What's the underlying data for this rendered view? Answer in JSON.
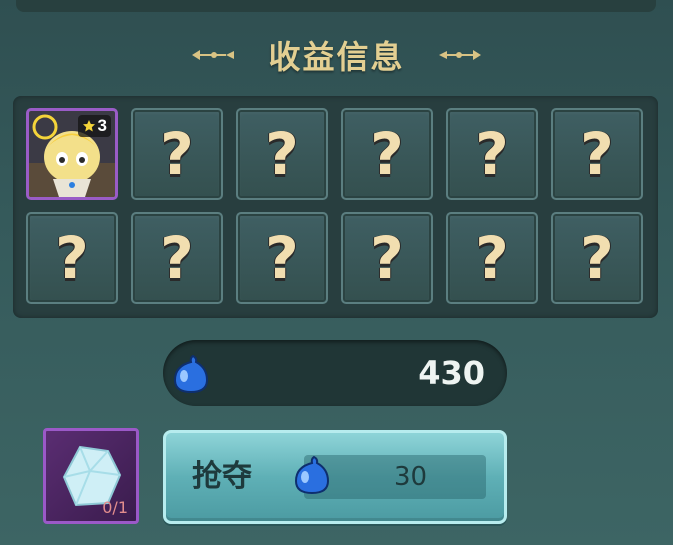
{
  "header": {
    "title": "收益信息",
    "title_color": "#e3cf92"
  },
  "reward_grid": {
    "rows": 2,
    "columns": 6,
    "slots": [
      {
        "state": "revealed",
        "item": "hero-card",
        "stars": "3",
        "frame_color": "#9a5cc7"
      },
      {
        "state": "hidden",
        "symbol": "?"
      },
      {
        "state": "hidden",
        "symbol": "?"
      },
      {
        "state": "hidden",
        "symbol": "?"
      },
      {
        "state": "hidden",
        "symbol": "?"
      },
      {
        "state": "hidden",
        "symbol": "?"
      },
      {
        "state": "hidden",
        "symbol": "?"
      },
      {
        "state": "hidden",
        "symbol": "?"
      },
      {
        "state": "hidden",
        "symbol": "?"
      },
      {
        "state": "hidden",
        "symbol": "?"
      },
      {
        "state": "hidden",
        "symbol": "?"
      },
      {
        "state": "hidden",
        "symbol": "?"
      }
    ]
  },
  "resource": {
    "icon": "water-drop-icon",
    "value": "430",
    "icon_color": "#2a6fe0"
  },
  "item_slot": {
    "icon": "crystal-icon",
    "count": "0/1",
    "frame_color": "#9b59c8"
  },
  "action_button": {
    "label": "抢夺",
    "cost_icon": "water-drop-icon",
    "cost": "30",
    "color": "#5fb0b6"
  }
}
